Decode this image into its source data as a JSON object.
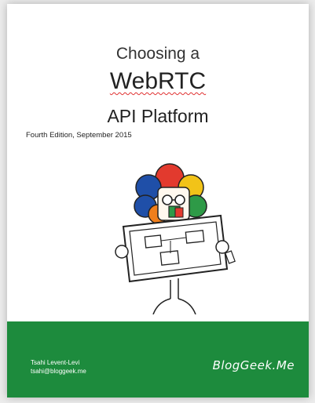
{
  "cover": {
    "title_line1": "Choosing a",
    "title_line2": "WebRTC",
    "title_line3": "API Platform",
    "edition": "Fourth Edition, September 2015",
    "author_name": "Tsahi Levent-Levi",
    "author_email": "tsahi@bloggeek.me",
    "brand": "BlogGeek.Me"
  },
  "colors": {
    "footer_green": "#1d8b3d",
    "flower_petals": [
      "#1f4fa8",
      "#e23a2e",
      "#f2c318",
      "#2e9a47",
      "#f07f1c"
    ]
  },
  "icons": {
    "illustration": "cartoon-character-holding-diagram"
  }
}
